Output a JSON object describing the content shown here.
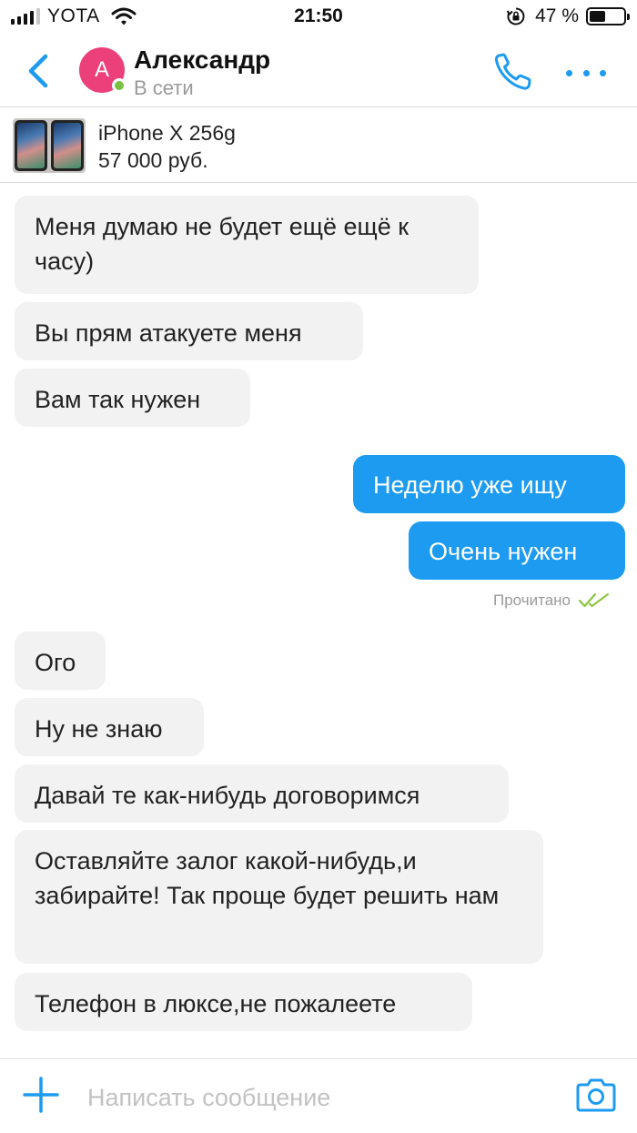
{
  "status_bar": {
    "carrier": "YOTA",
    "time": "21:50",
    "battery_percent": "47 %",
    "battery_level": 0.47,
    "signal_bars": 4,
    "signal_bars_total": 5
  },
  "header": {
    "back_icon": "chevron-left-icon",
    "avatar_letter": "А",
    "avatar_color": "#ec407a",
    "contact_name": "Александр",
    "contact_status": "В сети",
    "call_icon": "phone-icon",
    "more_icon": "more-dots-icon"
  },
  "product": {
    "title": "iPhone X 256g",
    "price": "57 000 руб."
  },
  "messages": [
    {
      "direction": "in",
      "text": "Меня думаю не будет ещё ещё к часу)"
    },
    {
      "direction": "in",
      "text": "Вы прям атакуете меня"
    },
    {
      "direction": "in",
      "text": "Вам так нужен"
    },
    {
      "direction": "out",
      "text": "Неделю уже ищу"
    },
    {
      "direction": "out",
      "text": "Очень нужен"
    },
    {
      "direction": "in",
      "text": "Ого"
    },
    {
      "direction": "in",
      "text": "Ну не знаю"
    },
    {
      "direction": "in",
      "text": "Давай те как-нибудь договоримся"
    },
    {
      "direction": "in",
      "text": "Оставляйте залог какой-нибудь,и забирайте! Так проще будет решить нам"
    },
    {
      "direction": "in",
      "text": "Телефон в люксе,не пожалеете"
    }
  ],
  "read_status": "Прочитано",
  "composer": {
    "placeholder": "Написать сообщение",
    "value": ""
  },
  "colors": {
    "accent": "#1c9bf0",
    "incoming_bubble": "#f2f2f2",
    "online": "#7ac143",
    "read_check": "#8cc63f"
  }
}
